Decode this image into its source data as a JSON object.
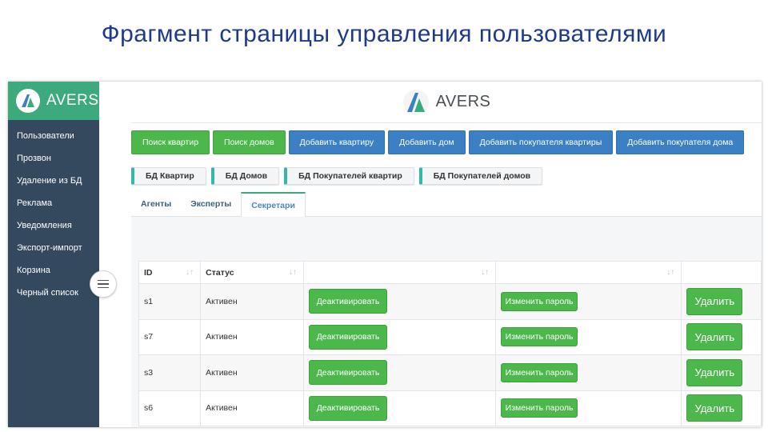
{
  "slide": {
    "title": "Фрагмент страницы управления пользователями"
  },
  "sidebar": {
    "brand": "AVERS",
    "items": [
      {
        "label": "Пользователи"
      },
      {
        "label": "Прозвон"
      },
      {
        "label": "Удаление из БД"
      },
      {
        "label": "Реклама"
      },
      {
        "label": "Уведомления"
      },
      {
        "label": "Экспорт-импорт"
      },
      {
        "label": "Корзина"
      },
      {
        "label": "Черный список"
      }
    ]
  },
  "header": {
    "brand": "AVERS"
  },
  "actions": [
    {
      "label": "Поиск квартир",
      "color": "green"
    },
    {
      "label": "Поиск домов",
      "color": "green"
    },
    {
      "label": "Добавить квартиру",
      "color": "blue"
    },
    {
      "label": "Добавить дом",
      "color": "blue"
    },
    {
      "label": "Добавить покупателя квартиры",
      "color": "blue"
    },
    {
      "label": "Добавить покупателя дома",
      "color": "blue"
    }
  ],
  "databases": [
    {
      "label": "БД Квартир"
    },
    {
      "label": "БД Домов"
    },
    {
      "label": "БД Покупателей квартир"
    },
    {
      "label": "БД Покупателей домов"
    }
  ],
  "tabs": [
    {
      "label": "Агенты",
      "active": false
    },
    {
      "label": "Эксперты",
      "active": false
    },
    {
      "label": "Секретари",
      "active": true
    }
  ],
  "table": {
    "columns": [
      "ID",
      "Статус",
      "",
      "",
      ""
    ],
    "rows": [
      {
        "id": "s1",
        "status": "Активен",
        "deactivate": "Деактивировать",
        "change_password": "Изменить пароль",
        "delete": "Удалить"
      },
      {
        "id": "s7",
        "status": "Активен",
        "deactivate": "Деактивировать",
        "change_password": "Изменить пароль",
        "delete": "Удалить"
      },
      {
        "id": "s3",
        "status": "Активен",
        "deactivate": "Деактивировать",
        "change_password": "Изменить пароль",
        "delete": "Удалить"
      },
      {
        "id": "s6",
        "status": "Активен",
        "deactivate": "Деактивировать",
        "change_password": "Изменить пароль",
        "delete": "Удалить"
      }
    ]
  },
  "colors": {
    "sidebar_bg": "#34495e",
    "brand_green": "#3daa7e",
    "button_green": "#4cb84c",
    "button_blue": "#3b7fc4",
    "title_blue": "#1f3a8a"
  },
  "icons": [
    "avers-logo-icon",
    "sort-icon",
    "hamburger-icon"
  ]
}
